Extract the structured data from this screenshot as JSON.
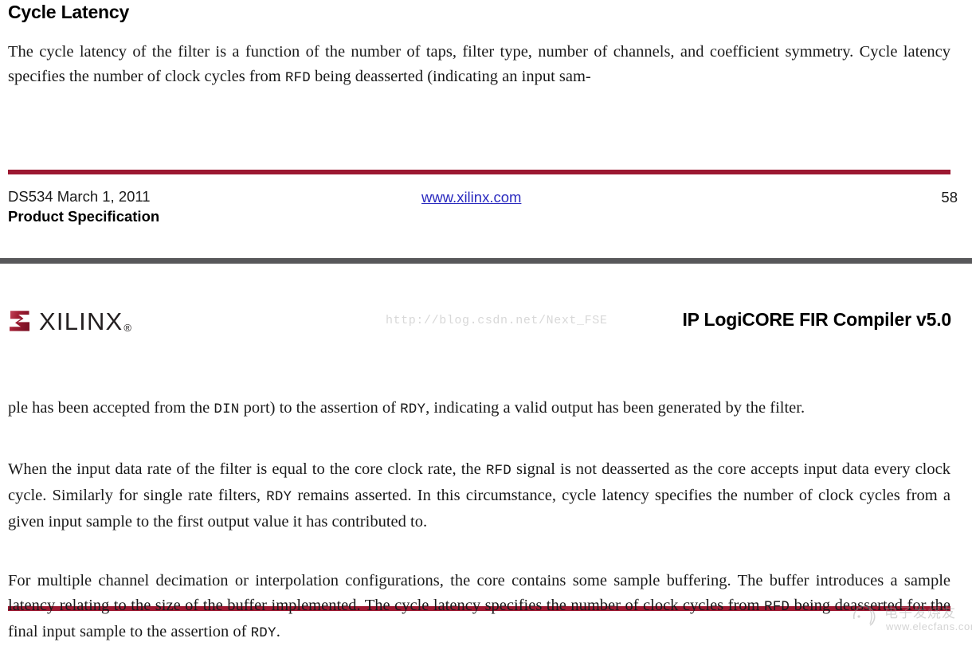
{
  "document": {
    "heading": "Cycle Latency",
    "intro_paragraph_parts": [
      {
        "type": "text",
        "value": "The cycle latency of the filter is a function of the number of taps, filter type, number of channels, and coefficient symmetry. Cycle latency specifies the number of clock cycles from "
      },
      {
        "type": "mono",
        "value": "RFD"
      },
      {
        "type": "text",
        "value": " being deasserted (indicating an input sam-"
      }
    ]
  },
  "footer": {
    "doc_id": "DS534 March 1, 2011",
    "spec_label": "Product Specification",
    "link": "www.xilinx.com",
    "page_number": "58"
  },
  "header": {
    "logo_word": "XILINX",
    "logo_registered": "®",
    "watermark": "http://blog.csdn.net/Next_FSE",
    "title": "IP LogiCORE FIR Compiler v5.0"
  },
  "body": {
    "paragraph_1": [
      {
        "type": "text",
        "value": "ple has been accepted from the "
      },
      {
        "type": "mono",
        "value": "DIN"
      },
      {
        "type": "text",
        "value": " port) to the assertion of "
      },
      {
        "type": "mono",
        "value": "RDY"
      },
      {
        "type": "text",
        "value": ", indicating a valid output has been generated by the filter."
      }
    ],
    "paragraph_2": [
      {
        "type": "text",
        "value": "When the input data rate of the filter is equal to the core clock rate, the "
      },
      {
        "type": "mono",
        "value": "RFD"
      },
      {
        "type": "text",
        "value": " signal is not deasserted as the core accepts input data every clock cycle. Similarly for single rate filters, "
      },
      {
        "type": "mono",
        "value": "RDY"
      },
      {
        "type": "text",
        "value": " remains asserted. In this circumstance, cycle latency specifies the number of clock cycles from a given input sample to the first output value it has contributed to."
      }
    ],
    "paragraph_3": [
      {
        "type": "text",
        "value": "For multiple channel decimation or interpolation configurations, the core contains some sample buffering. The buffer introduces a sample latency relating to the size of the buffer implemented. The cycle latency specifies the number of clock cycles from "
      },
      {
        "type": "mono",
        "value": "RFD"
      },
      {
        "type": "text",
        "value": " being deasserted for the final input sample to the assertion of "
      },
      {
        "type": "mono",
        "value": "RDY"
      },
      {
        "type": "text",
        "value": "."
      }
    ]
  },
  "corner_watermark": {
    "cjk_text": "电子发烧友",
    "url": "www.elecfans.com"
  },
  "colors": {
    "rule_red": "#9c1831",
    "link_blue": "#2b2bbf",
    "separator_gray": "#58585a",
    "logo_dark": "#231f20"
  }
}
